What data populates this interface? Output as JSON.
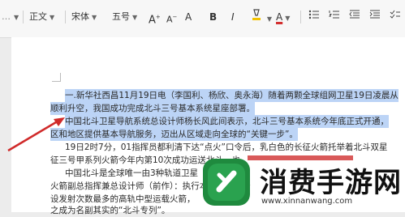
{
  "toolbar": {
    "style_label": "正文",
    "font_label": "宋体",
    "size_label": "五号",
    "grow_font_glyph": "A",
    "shrink_font_glyph": "A",
    "clear_format_glyph": "A",
    "bold_glyph": "B",
    "italic_glyph": "I",
    "underline_glyph": "U",
    "font_color_glyph": "A",
    "highlight_color": "#f2c200",
    "font_color": "#d32f2f"
  },
  "document": {
    "lines": [
      "一.新华社西昌11月19日电（李国利、杨欣、奥永海）随着两颗全球组网卫星19日凌晨从",
      "顺利升空，我国成功完成北斗三号基本系统星座部署。",
      "中国北斗卫星导航系统总设计师杨长风此间表示，北斗三号基本系统今年底正式开通，",
      "区和地区提供基本导航服务，迈出从区域走向全球的“关键一步”。",
      "19日2时7分，01指挥员都利清下达“点火”口令后，乳白色的长征火箭托举着北斗双星",
      "征三号甲系列火箭今年内第10次成功运送北斗，也",
      "中国北斗是全球唯一由3种轨道卫星",
      "火箭副总指挥兼总设计师（前作）：执行本次发射任务",
      "设发射次数最多的高轨中型运载火箭，",
      "之成为名副其实的“北斗专列”。"
    ]
  },
  "watermark": {
    "title": "消费手游网",
    "url": "www.xinnanwang.com"
  }
}
